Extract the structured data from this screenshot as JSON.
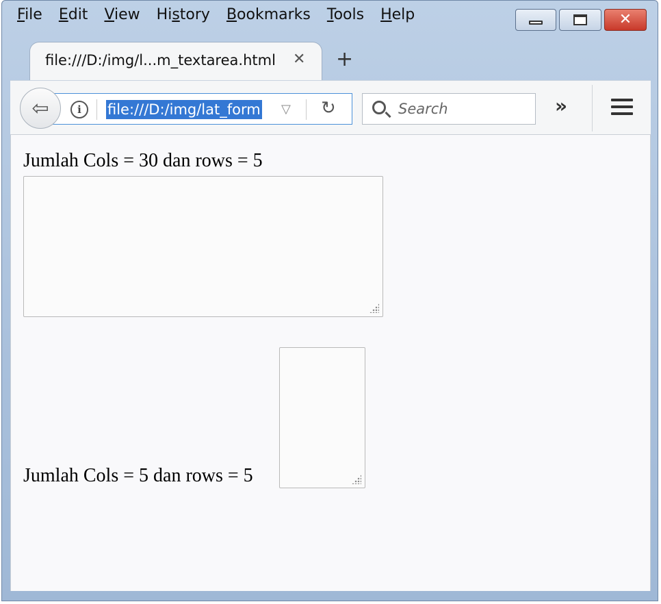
{
  "menubar": {
    "items": [
      {
        "accel": "F",
        "rest": "ile"
      },
      {
        "accel": "E",
        "rest": "dit"
      },
      {
        "accel": "V",
        "rest": "iew"
      },
      {
        "pre": "Hi",
        "accel": "s",
        "rest": "tory"
      },
      {
        "accel": "B",
        "rest": "ookmarks"
      },
      {
        "accel": "T",
        "rest": "ools"
      },
      {
        "accel": "H",
        "rest": "elp"
      }
    ]
  },
  "tab": {
    "title": "file:///D:/img/l...m_textarea.html",
    "close_glyph": "✕",
    "new_tab_glyph": "+"
  },
  "navbar": {
    "back_glyph": "⇦",
    "info_glyph": "i",
    "url": "file:///D:/img/lat_form",
    "dropdown_glyph": "▽",
    "reload_glyph": "↻",
    "search_placeholder": "Search",
    "overflow_glyph": "»"
  },
  "window_controls": {
    "close_glyph": "✕"
  },
  "page": {
    "label1": "Jumlah Cols = 30 dan rows = 5",
    "label2": "Jumlah Cols = 5 dan rows = 5",
    "textarea1_value": "",
    "textarea2_value": ""
  }
}
